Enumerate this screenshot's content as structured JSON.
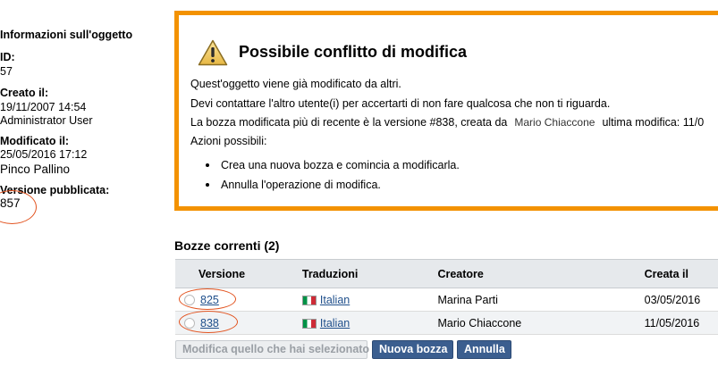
{
  "sidebar": {
    "title": "Informazioni sull'oggetto",
    "id_label": "ID:",
    "id_value": "57",
    "created_label": "Creato il:",
    "created_date": "19/11/2007 14:54",
    "created_by": "Administrator User",
    "modified_label": "Modificato il:",
    "modified_date": "25/05/2016 17:12",
    "modified_by": "Pinco Pallino",
    "published_label": "Versione pubblicata:",
    "published_value": "857"
  },
  "warning": {
    "icon": "warning-triangle-icon",
    "title": "Possibile conflitto di modifica",
    "line1": "Quest'oggetto viene già modificato da altri.",
    "line2": "Devi contattare l'altro utente(i) per accertarti di non fare qualcosa che non ti riguarda.",
    "line3_prefix": "La bozza modificata più di recente è la versione #838, creata da",
    "line3_user": "Mario Chiaccone",
    "line3_suffix": "ultima modifica: 11/0",
    "actions_label": "Azioni possibili:",
    "actions": [
      "Crea una nuova bozza e comincia a modificarla.",
      "Annulla l'operazione di modifica."
    ]
  },
  "drafts": {
    "heading": "Bozze correnti (2)",
    "columns": [
      "Versione",
      "Traduzioni",
      "Creatore",
      "Creata il"
    ],
    "rows": [
      {
        "version": "825",
        "language": "Italian",
        "creator": "Marina Parti",
        "created": "03/05/2016"
      },
      {
        "version": "838",
        "language": "Italian",
        "creator": "Mario Chiaccone",
        "created": "11/05/2016"
      }
    ]
  },
  "buttons": {
    "edit_selected": "Modifica quello che hai selezionato",
    "new_draft": "Nuova bozza",
    "cancel": "Annulla"
  },
  "colors": {
    "warning_border": "#f39200",
    "annotation_red": "#e2531f",
    "button_primary": "#3b5e8f",
    "link": "#1f4f8b"
  }
}
